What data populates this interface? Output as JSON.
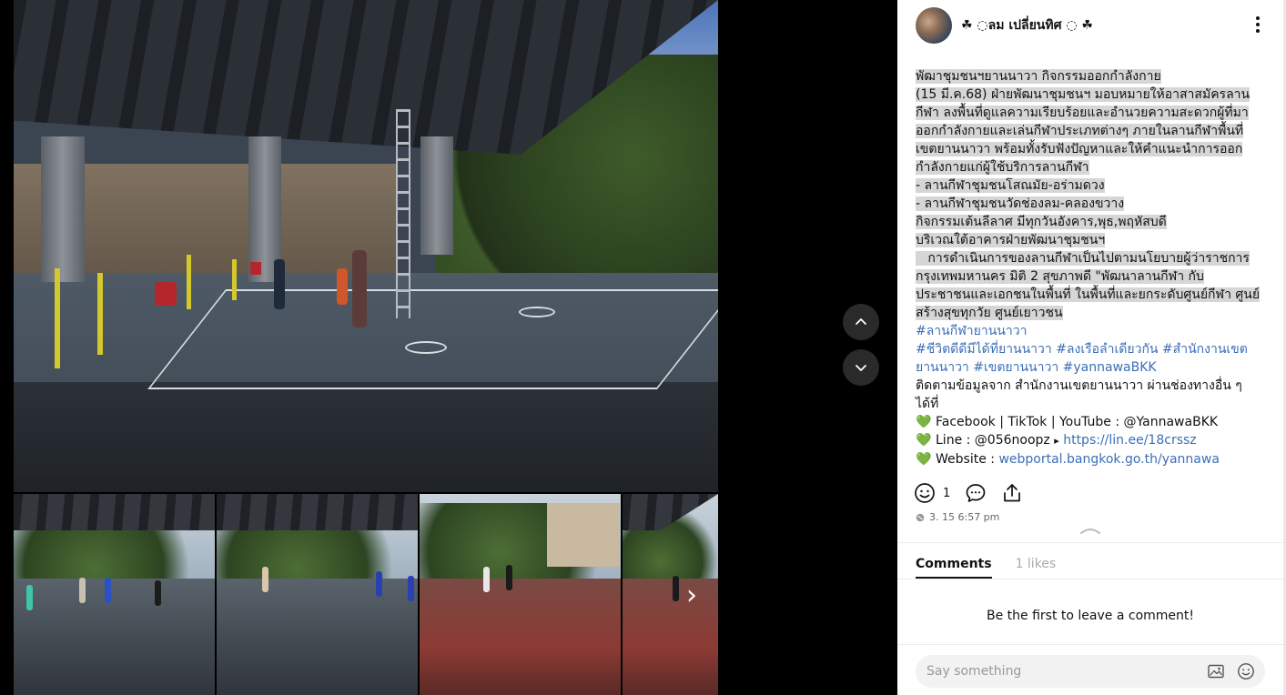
{
  "author": {
    "name": "☘ ◌ลม เปลี่ยนทิศ ◌ ☘"
  },
  "post": {
    "lines_highlighted": [
      "พัฒาชุมชนฯยานนาวา กิจกรรมออกกำลังกาย",
      " (15 มี.ค.68)  ฝ่ายพัฒนาชุมชนฯ มอบหมายให้อาสาสมัครลาน",
      "กีฬา ลงพื้นที่ดูแลความเรียบร้อยและอำนวยความสะดวกผู้ที่มา",
      "ออกกำลังกายและเล่นกีฬาประเภทต่างๆ ภายในลานกีฬาพื้นที่",
      "เขตยานนาวา พร้อมทั้งรับฟังปัญหาและให้คำแนะนำการออก",
      "กำลังกายแก่ผู้ใช้บริการลานกีฬา",
      "- ลานกีฬาชุมชนโสณมัย-อร่ามดวง",
      "- ลานกีฬาชุมชนวัดช่องลม-คลองขวาง",
      "กิจกรรมเต้นลีลาศ มีทุกวันอังคาร,พุธ,พฤหัสบดี",
      "บริเวณใต้อาคารฝ่ายพัฒนาชุมชนฯ",
      "   การดำเนินการของลานกีฬาเป็นไปตามนโยบายผู้ว่าราชการ",
      "กรุงเทพมหานคร  มิติ 2 สุขภาพดี  \"พัฒนาลานกีฬา กับ",
      "ประชาชนและเอกชนในพื้นที่ ในพื้นที่และยกระดับศูนย์กีฬา ศูนย์",
      "สร้างสุขทุกวัย ศูนย์เยาวชน"
    ],
    "hashtag_line1": "#ลานกีฬายานนาวา",
    "hashtag_line2": "#ชีวิตดีดีมีได้ที่ยานนาวา #ลงเรือลำเดียวกัน #สำนักงานเขต",
    "hashtag_line3": "ยานนาวา #เขตยานนาวา #yannawaBKK",
    "follow_line1": "ติดตามข้อมูลจาก สำนักงานเขตยานนาวา ผ่านช่องทางอื่น ๆ",
    "follow_line2": "ได้ที่",
    "social_label": "Facebook | TikTok | YouTube : @YannawaBKK",
    "line_label": "Line : @056noopz",
    "line_arrow": "▸",
    "line_url": "https://lin.ee/18crssz",
    "website_label": "Website : ",
    "website_url": "webportal.bangkok.go.th/yannawa",
    "heart": "💚"
  },
  "reactions": {
    "count": "1"
  },
  "timestamp": "3. 15 6:57 pm",
  "tabs": {
    "comments": "Comments",
    "likes": "1 likes"
  },
  "empty_message": "Be the first to leave a comment!",
  "comment_input": {
    "placeholder": "Say something"
  },
  "icons": {
    "thumb_next": "›"
  },
  "colors": {
    "hashtag": "#3b6fb6",
    "heart": "#15c163",
    "highlight": "#d6d6d6"
  }
}
